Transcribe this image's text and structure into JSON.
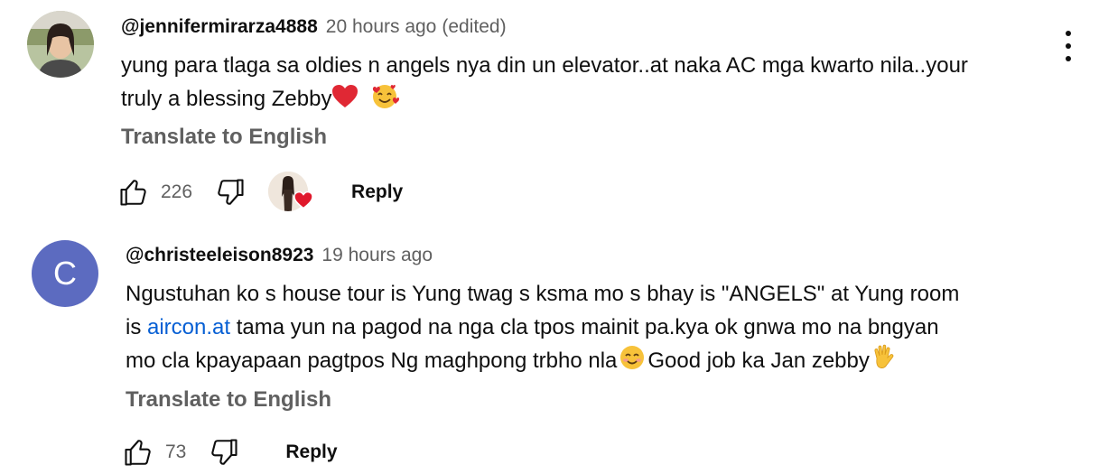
{
  "comments": [
    {
      "handle": "@jennifermirarza4888",
      "time": "20 hours ago",
      "edited": "(edited)",
      "lines": [
        "yung para tlaga sa oldies n angels nya din un elevator..at naka AC mga kwarto nila..your",
        "truly a blessing Zebby"
      ],
      "emojis": [
        "red-heart",
        "smiling-face-with-hearts"
      ],
      "translate_label": "Translate to English",
      "likes": "226",
      "reply_label": "Reply",
      "creator_heart": true
    },
    {
      "handle": "@christeeleison8923",
      "time": "19 hours ago",
      "avatar_letter": "C",
      "avatar_color": "#5c6bc0",
      "line1": "Ngustuhan ko s house tour is Yung twag s ksma mo s bhay is \"ANGELS\" at Yung room",
      "line2_prefix": "is ",
      "line2_link": "aircon.at",
      "line2_rest": " tama yun na pagod na nga cla tpos mainit pa.kya ok gnwa mo na bngyan",
      "line3_a": "mo cla kpayapaan pagtpos Ng maghpong trbho nla",
      "line3_b": "Good job ka Jan zebby",
      "emojis": [
        "smiling-face",
        "waving-hand"
      ],
      "translate_label": "Translate to English",
      "likes": "73",
      "reply_label": "Reply"
    }
  ],
  "icons": {
    "like": "thumbs-up-icon",
    "dislike": "thumbs-down-icon",
    "menu": "more-vert-icon"
  },
  "colors": {
    "link": "#065fd4",
    "secondary_text": "#606060",
    "primary_text": "#0f0f0f"
  }
}
